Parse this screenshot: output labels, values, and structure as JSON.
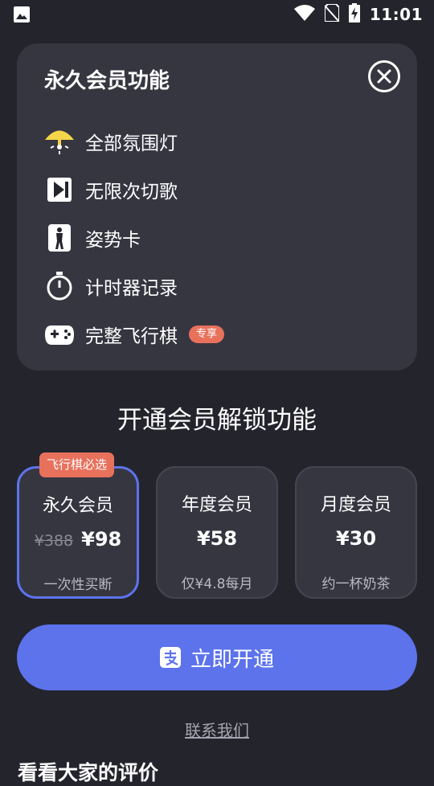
{
  "status_bar": {
    "time": "11:01"
  },
  "feature_card": {
    "title": "永久会员功能",
    "features": [
      {
        "label": "全部氛围灯",
        "icon": "lamp-icon"
      },
      {
        "label": "无限次切歌",
        "icon": "skip-next-icon"
      },
      {
        "label": "姿势卡",
        "icon": "pose-card-icon"
      },
      {
        "label": "计时器记录",
        "icon": "stopwatch-icon"
      },
      {
        "label": "完整飞行棋",
        "icon": "gamepad-icon",
        "badge": "专享"
      }
    ]
  },
  "section_title": "开通会员解锁功能",
  "plans": [
    {
      "name": "永久会员",
      "old_price": "¥388",
      "price": "¥98",
      "subtitle": "一次性买断",
      "tag": "飞行棋必选",
      "selected": true
    },
    {
      "name": "年度会员",
      "price": "¥58",
      "subtitle": "仅¥4.8每月",
      "selected": false
    },
    {
      "name": "月度会员",
      "price": "¥30",
      "subtitle": "约一杯奶茶",
      "selected": false
    }
  ],
  "open_button": {
    "label": "立即开通",
    "icon": "alipay-icon"
  },
  "contact_link": "联系我们",
  "reviews_title": "看看大家的评价",
  "colors": {
    "background": "#24242d",
    "card": "#363641",
    "accent": "#5d73ec",
    "badge": "#e8715c",
    "lamp": "#f5d54a"
  }
}
